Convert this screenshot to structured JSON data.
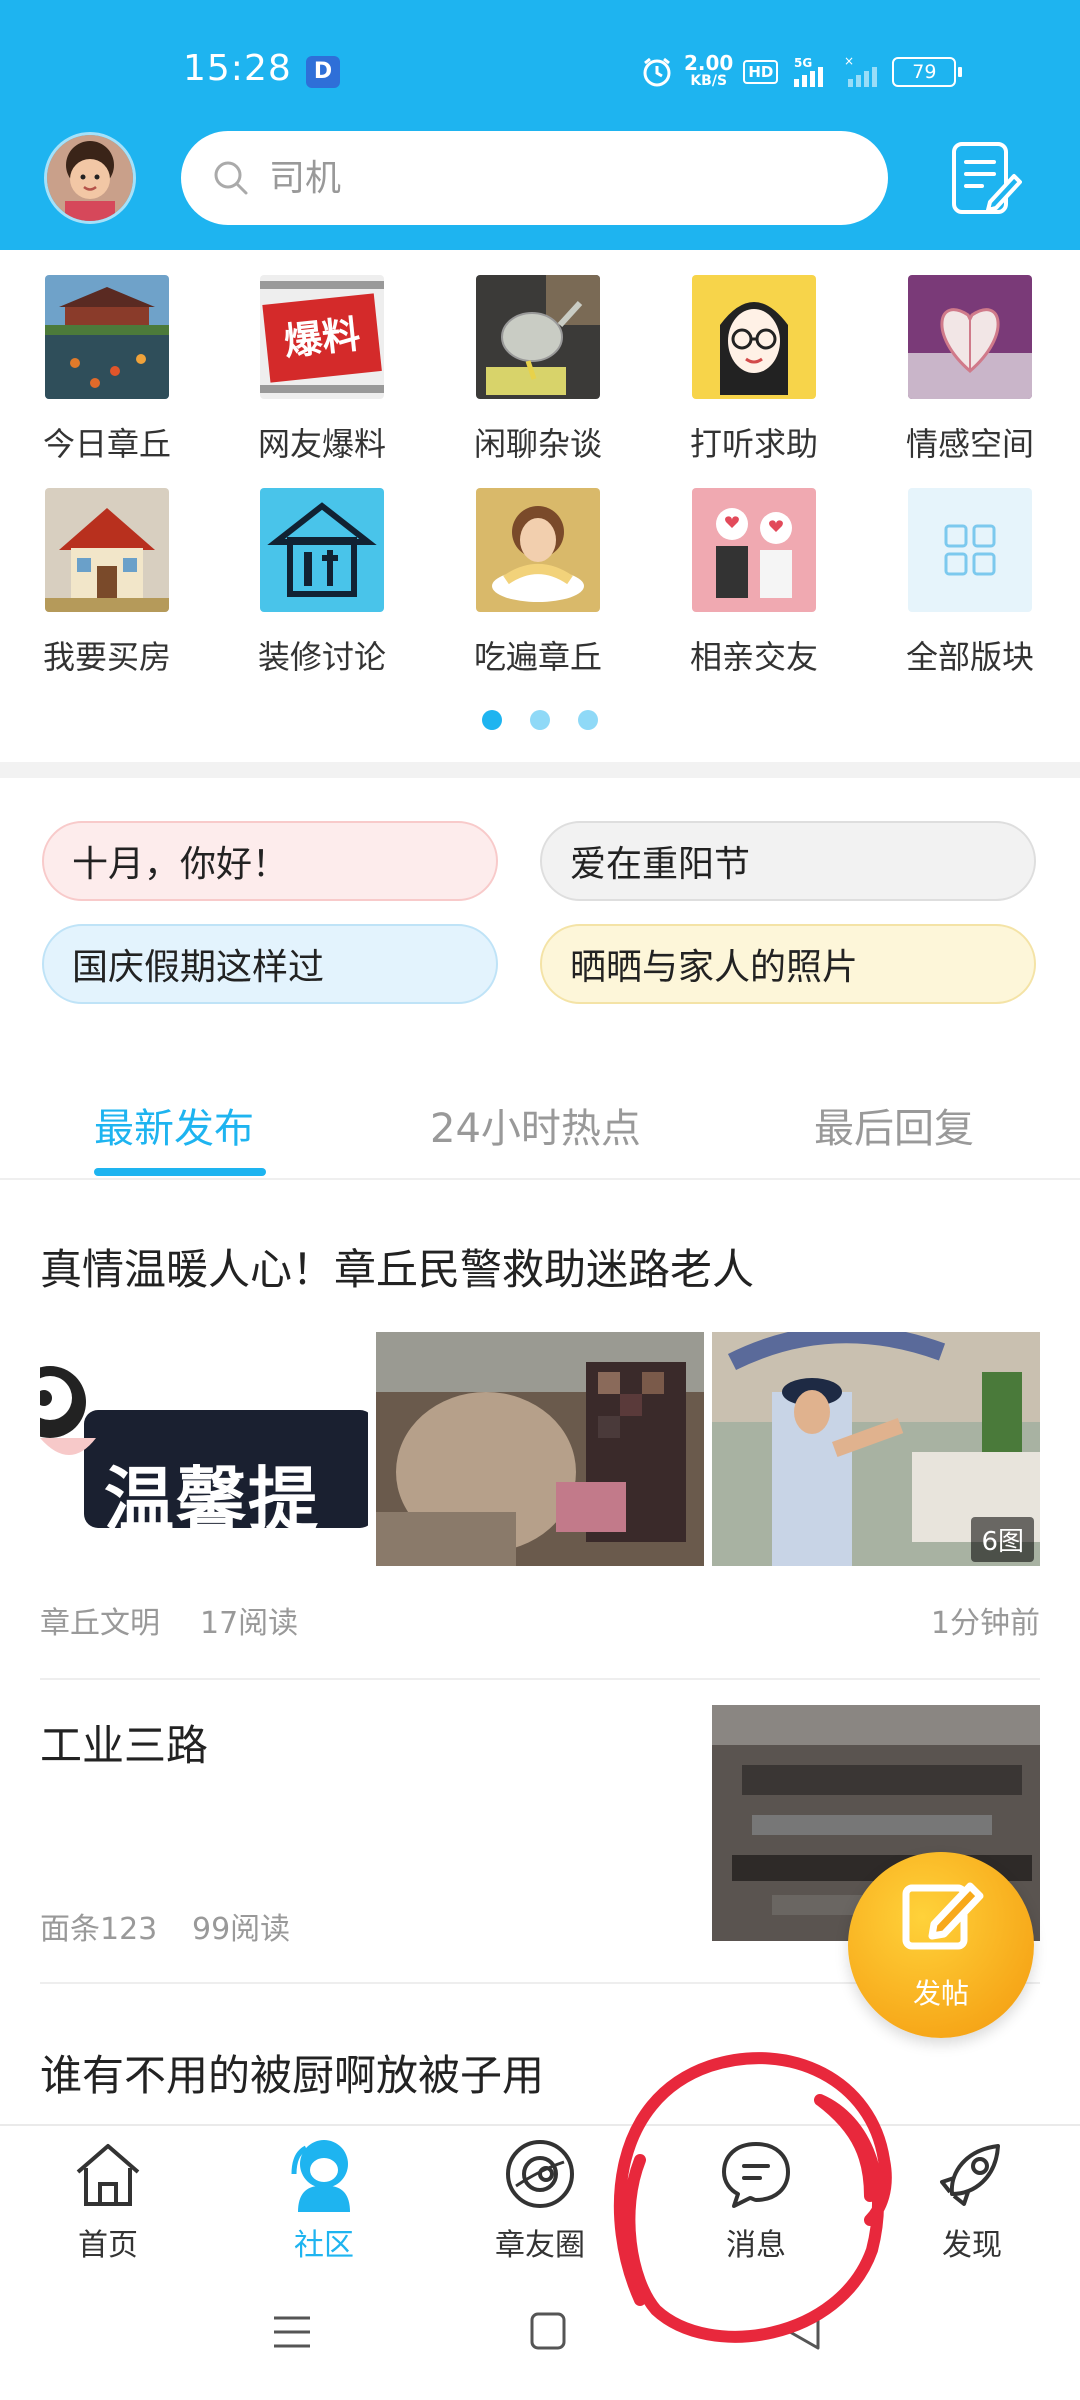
{
  "status_bar": {
    "time": "15:28",
    "app_badge": "D",
    "net_speed_value": "2.00",
    "net_speed_unit": "KB/S",
    "hd_label": "HD",
    "network": "5G",
    "battery": "79"
  },
  "header": {
    "search_placeholder": "司机"
  },
  "categories": [
    {
      "label": "今日章丘",
      "icon": "garden-photo"
    },
    {
      "label": "网友爆料",
      "icon": "news-scoop-logo"
    },
    {
      "label": "闲聊杂谈",
      "icon": "tea-pot-photo"
    },
    {
      "label": "打听求助",
      "icon": "cartoon-girl-glasses"
    },
    {
      "label": "情感空间",
      "icon": "book-heart-photo"
    },
    {
      "label": "我要买房",
      "icon": "house-photo"
    },
    {
      "label": "装修讨论",
      "icon": "house-tools-icon"
    },
    {
      "label": "吃遍章丘",
      "icon": "girl-eating-photo"
    },
    {
      "label": "相亲交友",
      "icon": "couple-photo"
    },
    {
      "label": "全部版块",
      "icon": "grid-icon"
    }
  ],
  "topic_tags": [
    "十月，你好！",
    "爱在重阳节",
    "国庆假期这样过",
    "晒晒与家人的照片"
  ],
  "tabs": [
    "最新发布",
    "24小时热点",
    "最后回复"
  ],
  "posts": [
    {
      "title": "真情温暖人心！章丘民警救助迷路老人",
      "author": "章丘文明",
      "reads": "17阅读",
      "time": "1分钟前",
      "thumb_text": "温馨提",
      "image_count": "6图"
    },
    {
      "title": "工业三路",
      "author": "面条123",
      "reads": "99阅读"
    },
    {
      "title": "谁有不用的被厨啊放被子用"
    }
  ],
  "fab": {
    "label": "发帖"
  },
  "bottom_nav": [
    {
      "label": "首页",
      "icon": "home-icon"
    },
    {
      "label": "社区",
      "icon": "community-icon",
      "active": true
    },
    {
      "label": "章友圈",
      "icon": "planet-icon"
    },
    {
      "label": "消息",
      "icon": "message-icon"
    },
    {
      "label": "发现",
      "icon": "rocket-icon"
    }
  ],
  "colors": {
    "primary": "#1eb4f0",
    "annotation": "#e8283c",
    "fab": "#f7a91a"
  }
}
